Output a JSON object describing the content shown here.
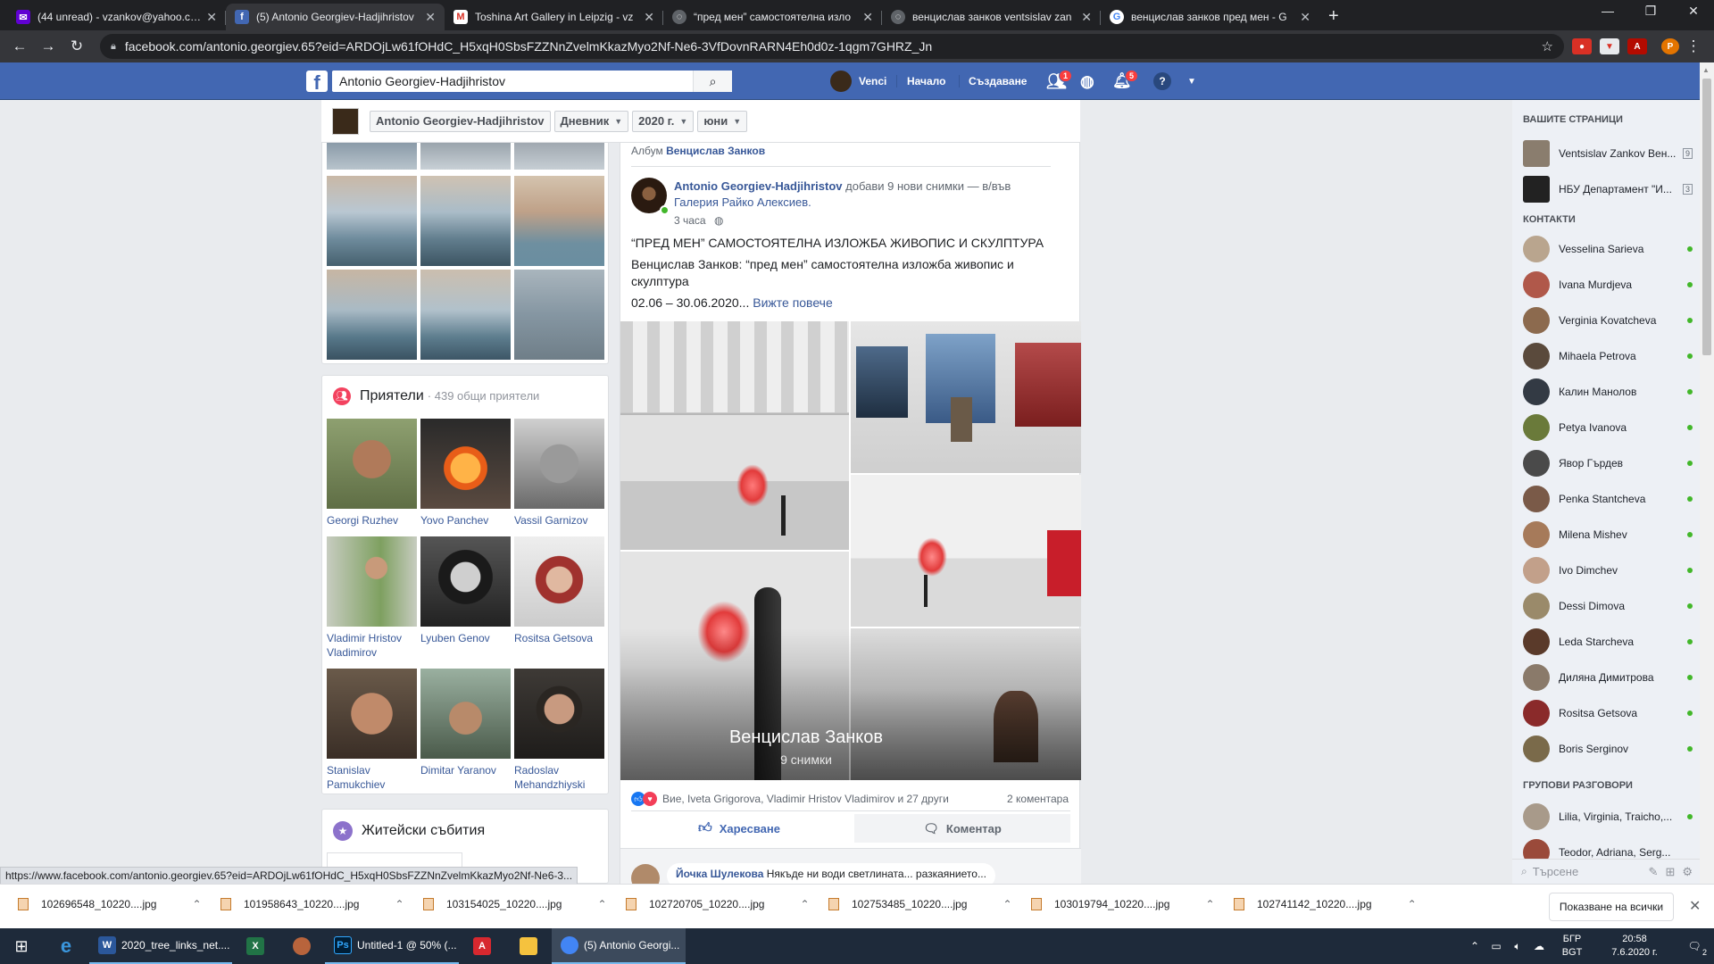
{
  "browser": {
    "tabs": [
      {
        "title": "(44 unread) - vzankov@yahoo.com",
        "favicon": "yahoo-mail-icon",
        "color": "#6001d2"
      },
      {
        "title": "(5) Antonio Georgiev-Hadjihristov",
        "favicon": "facebook-icon",
        "color": "#4267b2"
      },
      {
        "title": "Toshina Art Gallery in Leipzig - vz",
        "favicon": "gmail-icon",
        "color": "#d93025"
      },
      {
        "title": "“пред мен” самостоятелна изло",
        "favicon": "globe-icon",
        "color": "#5f6368"
      },
      {
        "title": "венцислав занков ventsislav zan",
        "favicon": "globe-icon",
        "color": "#5f6368"
      },
      {
        "title": "венцислав занков пред мен - G",
        "favicon": "google-icon",
        "color": "#4285f4"
      }
    ],
    "new_tab": "+",
    "url": "facebook.com/antonio.georgiev.65?eid=ARDOjLw61fOHdC_H5xqH0SbsFZZNnZvelmKkazMyo2Nf-Ne6-3VfDovnRARN4Eh0d0z-1qgm7GHRZ_Jn",
    "profile_initial": "P",
    "status_url": "https://www.facebook.com/antonio.georgiev.65?eid=ARDOjLw61fOHdC_H5xqH0SbsFZZNnZvelmKkazMyo2Nf-Ne6-3..."
  },
  "fb": {
    "search_value": "Antonio Georgiev-Hadjihristov",
    "user": "Venci",
    "nav_home": "Начало",
    "nav_create": "Създаване",
    "friend_badge": "1",
    "notif_badge": "5"
  },
  "timeline_header": {
    "name": "Antonio Georgiev-Hadjihristov",
    "section": "Дневник",
    "year": "2020 г.",
    "month": "юни"
  },
  "friends": {
    "title": "Приятели",
    "subtitle": "· 439 общи приятели",
    "people": [
      {
        "name": "Georgi Ruzhev",
        "color": "#6c7a4a"
      },
      {
        "name": "Yovo Panchev",
        "color": "#8a4a1c"
      },
      {
        "name": "Vassil Garnizov",
        "color": "#777777"
      },
      {
        "name": "Vladimir Hristov Vladimirov",
        "color": "#7b8c6a"
      },
      {
        "name": "Lyuben Genov",
        "color": "#3a3a3a"
      },
      {
        "name": "Rositsa Getsova",
        "color": "#a0322e"
      },
      {
        "name": "Stanislav Pamukchiev",
        "color": "#9c7b5a"
      },
      {
        "name": "Dimitar Yaranov",
        "color": "#6b7a5e"
      },
      {
        "name": "Radoslav Mehandzhiyski",
        "color": "#3e3a36"
      }
    ]
  },
  "life_events": {
    "title": "Житейски събития"
  },
  "post": {
    "album_label": "Албум",
    "album_name": "Венцислав Занков",
    "author": "Antonio Georgiev-Hadjihristov",
    "action": "добави 9 нови снимки — в/във",
    "place": "Галерия Райко Алексиев.",
    "time": "3 часа",
    "line1": "“ПРЕД МЕН” САМОСТОЯТЕЛНА ИЗЛОЖБА ЖИВОПИС И СКУЛПТУРА",
    "line2": "Венцислав Занков: “пред мен” самостоятелна изложба живопис и скулптура",
    "dates": "02.06 – 30.06.2020...",
    "see_more": "Вижте повече",
    "overlay_title": "Венцислав Занков",
    "overlay_count": "9 снимки",
    "reactions": "Вие, Iveta Grigorova, Vladimir Hristov Vladimirov и 27 други",
    "comments_count": "2 коментара",
    "like": "Харесване",
    "comment": "Коментар",
    "comment_author": "Йочка Шулекова",
    "comment_text": "Някъде ни води светлината... разкаянието..."
  },
  "sidebar": {
    "pages_title": "ВАШИТЕ СТРАНИЦИ",
    "pages": [
      {
        "name": "Ventsislav Zankov Вен...",
        "count": "9",
        "color": "#8a7d6e"
      },
      {
        "name": "НБУ Департамент \"И...",
        "count": "3",
        "color": "#222222"
      }
    ],
    "contacts_title": "КОНТАКТИ",
    "contacts": [
      {
        "name": "Vesselina Sarieva",
        "color": "#b9a58e"
      },
      {
        "name": "Ivana Murdjeva",
        "color": "#b0584a"
      },
      {
        "name": "Verginia Kovatcheva",
        "color": "#8c6a4e"
      },
      {
        "name": "Mihaela Petrova",
        "color": "#5a4a3c"
      },
      {
        "name": "Калин Манолов",
        "color": "#333a44"
      },
      {
        "name": "Petya Ivanova",
        "color": "#6a7a3a"
      },
      {
        "name": "Явор Гърдев",
        "color": "#4a4a4a"
      },
      {
        "name": "Penka Stantcheva",
        "color": "#7a5a48"
      },
      {
        "name": "Milena Mishev",
        "color": "#a67a5a"
      },
      {
        "name": "Ivo Dimchev",
        "color": "#c2a08a"
      },
      {
        "name": "Dessi Dimova",
        "color": "#9a8a6a"
      },
      {
        "name": "Leda Starcheva",
        "color": "#5a3a2a"
      },
      {
        "name": "Диляна Димитрова",
        "color": "#8a7a6a"
      },
      {
        "name": "Rositsa Getsova",
        "color": "#8a2a2a"
      },
      {
        "name": "Boris Serginov",
        "color": "#7a6a4a"
      }
    ],
    "groups_title": "ГРУПОВИ РАЗГОВОРИ",
    "groups": [
      {
        "name": "Lilia, Virginia, Traicho,...",
        "color": "#a89a8a"
      },
      {
        "name": "Teodor, Adriana, Serg...",
        "color": "#9a4a3a"
      }
    ],
    "search_placeholder": "Търсене"
  },
  "downloads": {
    "items": [
      "102696548_10220....jpg",
      "101958643_10220....jpg",
      "103154025_10220....jpg",
      "102720705_10220....jpg",
      "102753485_10220....jpg",
      "103019794_10220....jpg",
      "102741142_10220....jpg"
    ],
    "show_all": "Показване на всички"
  },
  "taskbar": {
    "word": "2020_tree_links_net....",
    "photoshop": "Untitled-1 @ 50% (...",
    "chrome": "(5) Antonio Georgi...",
    "lang1": "БГР",
    "lang2": "BGT",
    "time": "20:58",
    "date": "7.6.2020 г.",
    "notifications": "2"
  }
}
